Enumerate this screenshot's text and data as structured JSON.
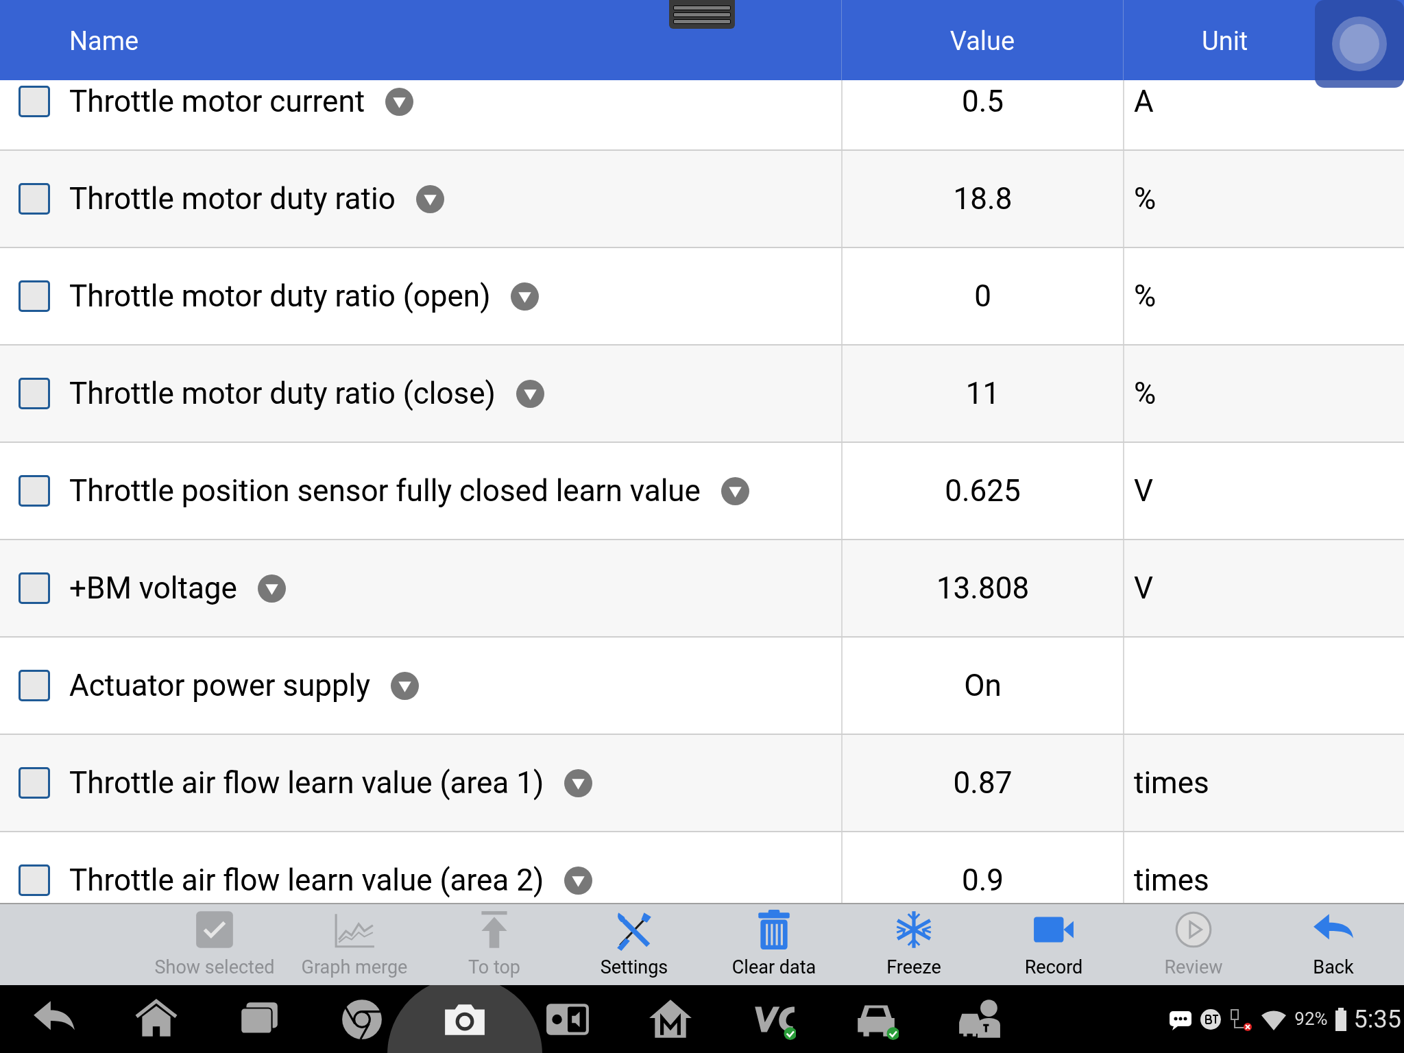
{
  "table": {
    "columns": [
      "Name",
      "Value",
      "Unit"
    ],
    "rows": [
      {
        "name": "Throttle motor current",
        "value": "0.5",
        "unit": "A",
        "checked": false
      },
      {
        "name": "Throttle motor duty ratio",
        "value": "18.8",
        "unit": "%",
        "checked": false
      },
      {
        "name": "Throttle motor duty ratio (open)",
        "value": "0",
        "unit": "%",
        "checked": false
      },
      {
        "name": "Throttle motor duty ratio (close)",
        "value": "11",
        "unit": "%",
        "checked": false
      },
      {
        "name": "Throttle position sensor fully closed learn value",
        "value": "0.625",
        "unit": "V",
        "checked": false
      },
      {
        "name": "+BM voltage",
        "value": "13.808",
        "unit": "V",
        "checked": false
      },
      {
        "name": "Actuator power supply",
        "value": "On",
        "checked": false
      },
      {
        "name": "Throttle air flow learn value (area 1)",
        "value": "0.87",
        "unit": "times",
        "checked": false
      },
      {
        "name": "Throttle air flow learn value (area 2)",
        "value": "0.9",
        "unit": "times",
        "checked": false
      }
    ]
  },
  "toolbar": [
    {
      "kind": "check",
      "label": "Show selected",
      "disabled": true
    },
    {
      "kind": "graph",
      "label": "Graph merge",
      "disabled": true
    },
    {
      "kind": "top",
      "label": "To top",
      "disabled": true
    },
    {
      "kind": "settings",
      "label": "Settings",
      "disabled": false
    },
    {
      "kind": "trash",
      "label": "Clear data",
      "disabled": false
    },
    {
      "kind": "freeze",
      "label": "Freeze",
      "disabled": false
    },
    {
      "kind": "record",
      "label": "Record",
      "disabled": false
    },
    {
      "kind": "play",
      "label": "Review",
      "disabled": true
    },
    {
      "kind": "back",
      "label": "Back",
      "disabled": false
    }
  ],
  "nav_bar": [
    {
      "kind": "back"
    },
    {
      "kind": "home"
    },
    {
      "kind": "recents"
    },
    {
      "kind": "browser"
    },
    {
      "kind": "camera",
      "selected": true
    },
    {
      "kind": "display"
    },
    {
      "kind": "m-home"
    },
    {
      "kind": "vci"
    },
    {
      "kind": "car"
    },
    {
      "kind": "service"
    }
  ],
  "status_bar": {
    "battery": "92%",
    "time": "5:35"
  }
}
